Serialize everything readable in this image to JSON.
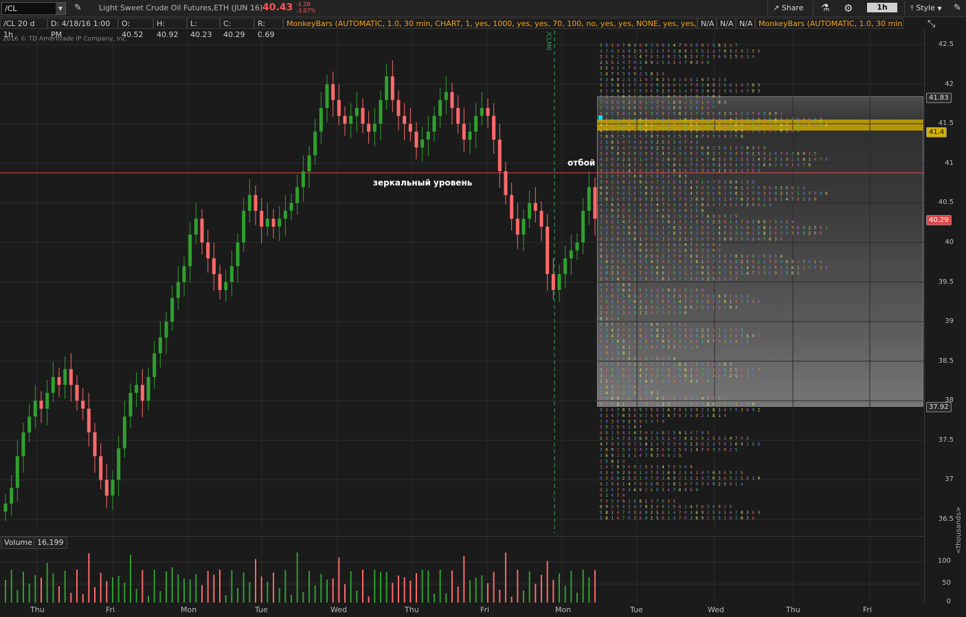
{
  "toolbar": {
    "symbol": "/CL",
    "description": "Light Sweet Crude Oil Futures,ETH (JUN 16)",
    "last_price": "40.43",
    "change_abs": "-1.28",
    "change_pct": "-3.07%",
    "share_label": "Share",
    "timeframe": "1h",
    "style_label": "Style"
  },
  "info": {
    "chart_desc": "/CL 20 d 1h",
    "date": "D: 4/18/16 1:00 PM",
    "open": "O: 40.52",
    "high": "H: 40.92",
    "low": "L: 40.23",
    "close": "C: 40.29",
    "range": "R: 0.69",
    "study": "MonkeyBars (AUTOMATIC, 1.0, 30 min, CHART, 1, yes, 1000, yes, yes, 70, 100, no, yes, yes, NONE, yes, yes, 70, yes, 3)",
    "na1": "N/A",
    "na2": "N/A",
    "na3": "N/A",
    "study2": "MonkeyBars (AUTOMATIC, 1.0, 30 min,..."
  },
  "copyright": "2016 © TD Ameritrade IP Company, Inc.",
  "annotations": {
    "mirror_level": "зеркальный уровень",
    "rebound": "отбой",
    "contract_marker": "/CLM6"
  },
  "price_axis": {
    "ticks": [
      "42.5",
      "42",
      "41.5",
      "41",
      "40.5",
      "40",
      "39.5",
      "39",
      "38.5",
      "38",
      "37.5",
      "37",
      "36.5"
    ],
    "tags": [
      {
        "value": "41.83",
        "color": "#2a2a2a",
        "text_color": "#e0e0e0"
      },
      {
        "value": "41.4",
        "color": "#d4b000",
        "text_color": "#111111"
      },
      {
        "value": "40.29",
        "color": "#e04848",
        "text_color": "#ffffff"
      },
      {
        "value": "37.92",
        "color": "#2a2a2a",
        "text_color": "#e0e0e0"
      }
    ]
  },
  "volume": {
    "label": "Volume",
    "value": "16,199",
    "ticks": [
      "100",
      "50",
      "0"
    ],
    "unit": "<thousands>"
  },
  "days": [
    "Thu",
    "Fri",
    "Mon",
    "Tue",
    "Wed",
    "Thu",
    "Fri",
    "Mon",
    "Tue",
    "Wed",
    "Thu",
    "Fri"
  ],
  "colors": {
    "up": "#2fa02f",
    "down": "#ff6a6a",
    "level_line": "#e04848",
    "bg": "#1b1b1b"
  },
  "chart_data": {
    "type": "candlestick",
    "title": "/CL 20 d 1h",
    "ylim": [
      36.2,
      42.7
    ],
    "level": 40.88,
    "series": [
      {
        "name": "/CL",
        "values": [
          36.7,
          36.9,
          37.3,
          37.6,
          37.8,
          38.0,
          37.9,
          38.1,
          38.3,
          38.2,
          38.4,
          38.2,
          38.0,
          37.9,
          37.6,
          37.3,
          37.0,
          36.8,
          37.0,
          37.4,
          37.8,
          38.1,
          38.2,
          38.0,
          38.3,
          38.6,
          38.8,
          39.0,
          39.3,
          39.5,
          39.7,
          40.1,
          40.3,
          40.0,
          39.8,
          39.6,
          39.4,
          39.5,
          39.7,
          40.0,
          40.4,
          40.6,
          40.4,
          40.2,
          40.3,
          40.2,
          40.3,
          40.4,
          40.5,
          40.7,
          40.9,
          41.1,
          41.4,
          41.7,
          42.0,
          41.8,
          41.6,
          41.5,
          41.6,
          41.7,
          41.5,
          41.4,
          41.5,
          41.8,
          42.1,
          41.8,
          41.6,
          41.5,
          41.4,
          41.2,
          41.3,
          41.4,
          41.6,
          41.8,
          41.9,
          41.7,
          41.5,
          41.3,
          41.4,
          41.6,
          41.7,
          41.6,
          41.3,
          40.9,
          40.6,
          40.3,
          40.1,
          40.3,
          40.5,
          40.4,
          40.2,
          39.6,
          39.4,
          39.6,
          39.8,
          39.9,
          40.0,
          40.4,
          40.7,
          40.3
        ]
      }
    ]
  }
}
